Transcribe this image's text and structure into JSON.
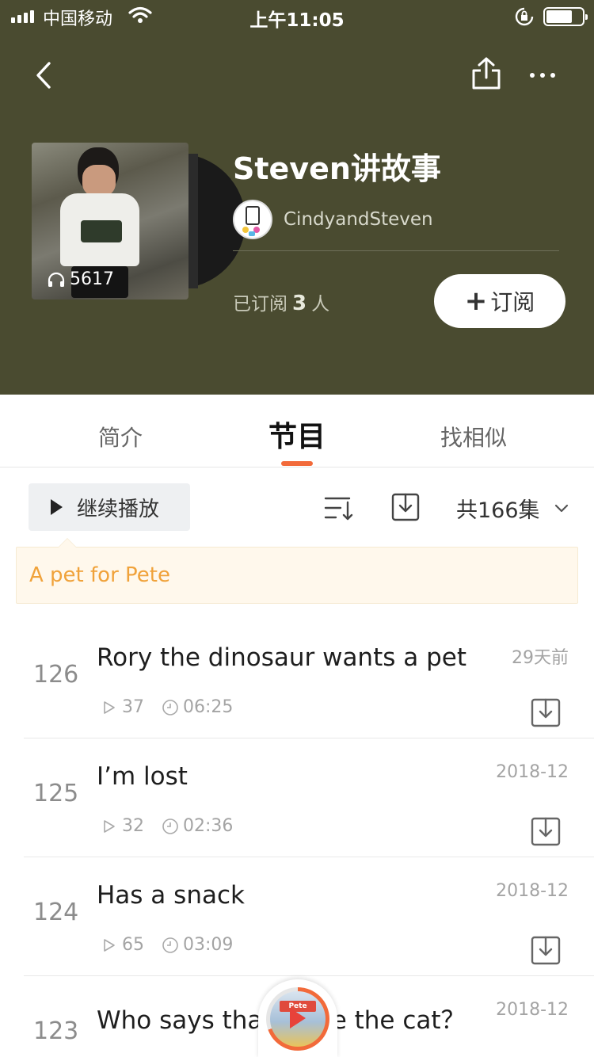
{
  "status_bar": {
    "carrier": "中国移动",
    "time": "上午11:05"
  },
  "program": {
    "title": "Steven讲故事",
    "listen_count": "5617",
    "author_name": "CindyandSteven",
    "subscribed_prefix": "已订阅",
    "subscribed_count": "3",
    "subscribed_suffix": "人",
    "subscribe_label": "订阅"
  },
  "tabs": [
    {
      "label": "简介",
      "active": false
    },
    {
      "label": "节目",
      "active": true
    },
    {
      "label": "找相似",
      "active": false
    }
  ],
  "toolbar": {
    "continue_label": "继续播放",
    "episode_count": "共166集"
  },
  "last_played": {
    "title": "A pet for Pete"
  },
  "episodes": [
    {
      "number": "126",
      "title": "Rory the dinosaur wants a pet",
      "date": "29天前",
      "plays": "37",
      "duration": "06:25"
    },
    {
      "number": "125",
      "title": "I’m lost",
      "date": "2018-12",
      "plays": "32",
      "duration": "02:36"
    },
    {
      "number": "124",
      "title": "Has a snack",
      "date": "2018-12",
      "plays": "65",
      "duration": "03:09"
    },
    {
      "number": "123",
      "title": "Who says that? Pete the cat？",
      "date": "2018-12",
      "plays": "",
      "duration": ""
    }
  ],
  "colors": {
    "header_bg": "#4a4b30",
    "accent": "#f26a3a",
    "last_played_text": "#f0a23a"
  },
  "icons": [
    "back-icon",
    "share-icon",
    "more-icon",
    "headphones-icon",
    "sort-icon",
    "download-all-icon",
    "chevron-down-icon",
    "play-icon",
    "clock-icon",
    "download-icon"
  ]
}
